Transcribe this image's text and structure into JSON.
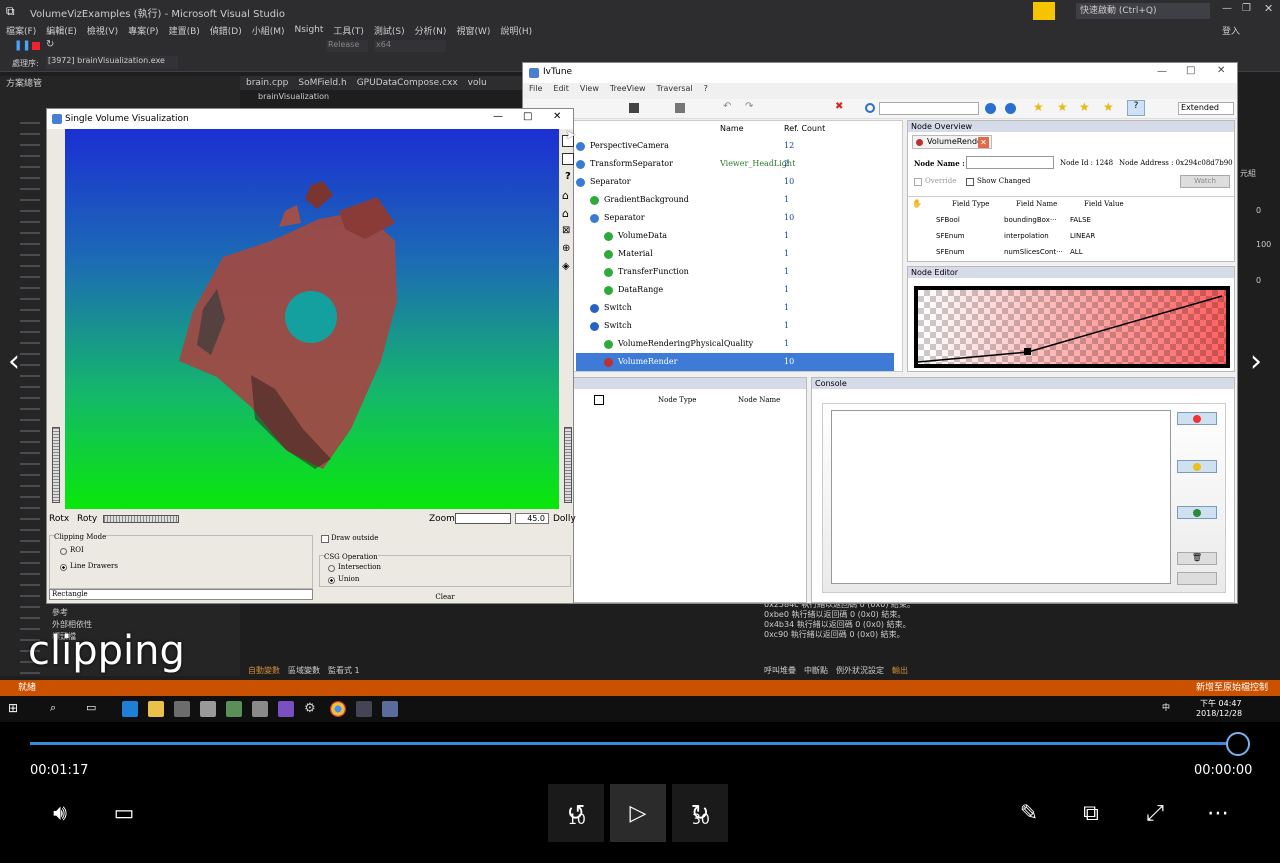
{
  "vs": {
    "title": "VolumeVizExamples (執行) - Microsoft Visual Studio",
    "quick_launch": "快速啟動 (Ctrl+Q)",
    "login": "登入",
    "menu": [
      "檔案(F)",
      "編輯(E)",
      "檢視(V)",
      "專案(P)",
      "建置(B)",
      "偵錯(D)",
      "小組(M)",
      "Nsight",
      "工具(T)",
      "測試(S)",
      "分析(N)",
      "視窗(W)",
      "說明(H)"
    ],
    "config": "Release",
    "platform": "x64",
    "process": "[3972] brainVisualization.exe",
    "process_label": "處理序:",
    "tabs": [
      "brain.cpp",
      "SoMField.h",
      "GPUDataCompose.cxx",
      "volu"
    ],
    "solution_explorer": "方案總管",
    "project": "brainVisualization",
    "tree_items": [
      "參考",
      "外部相依性",
      "標頭檔"
    ],
    "output_lines": [
      "0x2584c 執行緒以返回碼 0 (0x0) 結束。",
      "0xbe0 執行緒以返回碼 0 (0x0) 結束。",
      "0x4b34 執行緒以返回碼 0 (0x0) 結束。",
      "0xc90 執行緒以返回碼 0 (0x0) 結束。"
    ],
    "bottom_tabs": [
      "自動變數",
      "區域變數",
      "監看式 1"
    ],
    "bottom_tabs_right": [
      "呼叫堆疊",
      "中斷點",
      "例外狀況設定",
      "輸出"
    ],
    "status": "就緒",
    "status_right": "新增至原始檔控制",
    "side_numbers": [
      "元組",
      "100",
      "0",
      "0"
    ]
  },
  "taskbar": {
    "time": "下午 04:47",
    "date": "2018/12/28",
    "ime": "中"
  },
  "svv": {
    "title": "Single Volume Visualization",
    "rotx": "Rotx",
    "roty": "Roty",
    "zoom": "Zoom",
    "zoom_value": "45.0",
    "dolly": "Dolly",
    "clipping_mode": "Clipping Mode",
    "roi": "ROI",
    "line_drawers": "Line Drawers",
    "draw_outside": "Draw outside",
    "csg_operation": "CSG Operation",
    "intersection": "Intersection",
    "union": "Union",
    "shape": "Rectangle",
    "clear": "Clear"
  },
  "ivtune": {
    "title": "IvTune",
    "menu": [
      "File",
      "Edit",
      "View",
      "TreeView",
      "Traversal",
      "?"
    ],
    "mode": "Extended",
    "col_name": "Name",
    "col_ref": "Ref. Count",
    "nodes": [
      {
        "label": "PerspectiveCamera",
        "name": "",
        "ref": "12",
        "color": "#3a7bd5",
        "indent": 0
      },
      {
        "label": "TransformSeparator",
        "name": "Viewer_HeadLight",
        "ref": "2",
        "color": "#3a7bd5",
        "indent": 0
      },
      {
        "label": "Separator",
        "name": "",
        "ref": "10",
        "color": "#3a7bd5",
        "indent": 0
      },
      {
        "label": "GradientBackground",
        "name": "",
        "ref": "1",
        "color": "#2eaa3a",
        "indent": 1
      },
      {
        "label": "Separator",
        "name": "",
        "ref": "10",
        "color": "#3a7bd5",
        "indent": 1
      },
      {
        "label": "VolumeData",
        "name": "",
        "ref": "1",
        "color": "#2eaa3a",
        "indent": 2
      },
      {
        "label": "Material",
        "name": "",
        "ref": "1",
        "color": "#2eaa3a",
        "indent": 2
      },
      {
        "label": "TransferFunction",
        "name": "",
        "ref": "1",
        "color": "#2eaa3a",
        "indent": 2
      },
      {
        "label": "DataRange",
        "name": "",
        "ref": "1",
        "color": "#2eaa3a",
        "indent": 2
      },
      {
        "label": "Switch",
        "name": "",
        "ref": "1",
        "color": "#2563c4",
        "indent": 1
      },
      {
        "label": "Switch",
        "name": "",
        "ref": "1",
        "color": "#2563c4",
        "indent": 1
      },
      {
        "label": "VolumeRenderingPhysicalQuality",
        "name": "",
        "ref": "1",
        "color": "#2eaa3a",
        "indent": 2
      },
      {
        "label": "VolumeRender",
        "name": "",
        "ref": "10",
        "color": "#c03030",
        "indent": 2
      }
    ],
    "node_overview": "Node Overview",
    "node_tab": "VolumeRender",
    "node_name_label": "Node Name :",
    "node_id": "Node Id : 1248",
    "node_address": "Node Address : 0x294c08d7b90",
    "override": "Override",
    "show_changed": "Show Changed",
    "watch": "Watch",
    "field_type": "Field Type",
    "field_name": "Field Name",
    "field_value": "Field Value",
    "fields": [
      {
        "type": "SFBool",
        "name": "boundingBox···",
        "value": "FALSE"
      },
      {
        "type": "SFEnum",
        "name": "interpolation",
        "value": "LINEAR"
      },
      {
        "type": "SFEnum",
        "name": "numSlicesCont···",
        "value": "ALL"
      }
    ],
    "node_editor": "Node Editor",
    "node_type": "Node Type",
    "node_name": "Node Name",
    "console": "Console"
  },
  "player": {
    "caption": "clipping",
    "elapsed": "00:01:17",
    "remaining": "00:00:00",
    "progress": 1.0,
    "rewind": "10",
    "forward": "30"
  }
}
